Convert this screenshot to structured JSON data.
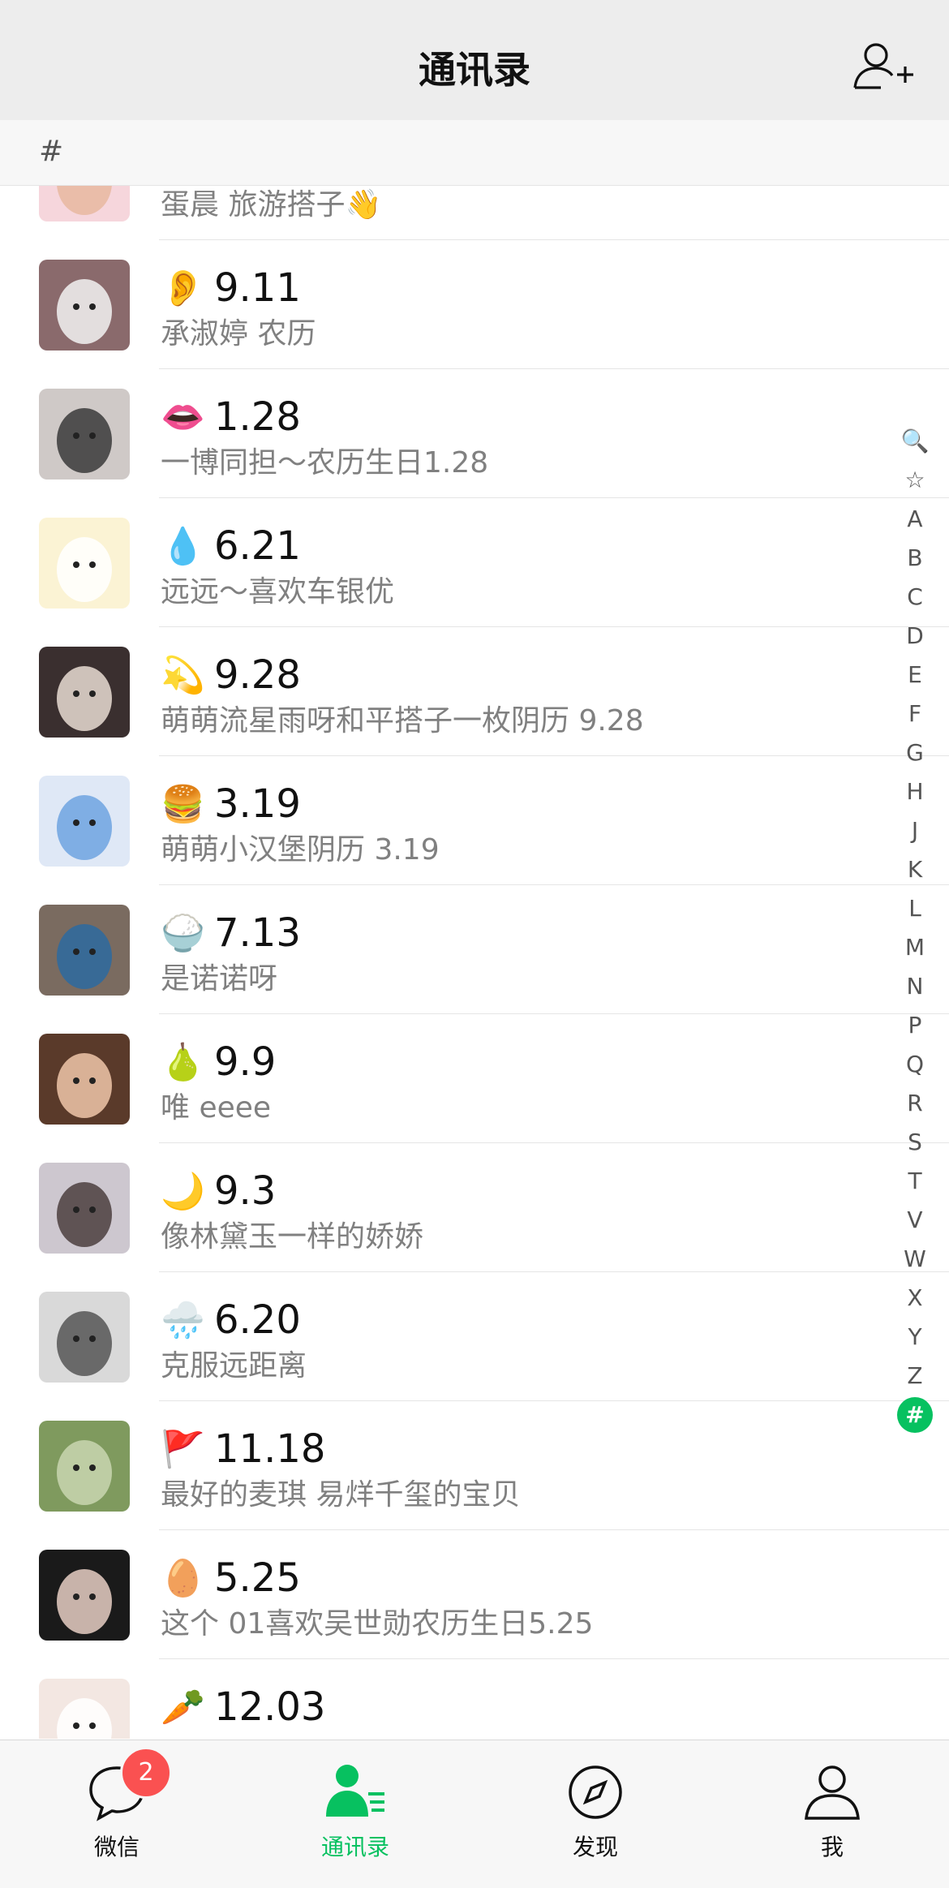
{
  "header": {
    "title": "通讯录",
    "add_icon": "add-contact-icon"
  },
  "section": {
    "label": "#"
  },
  "contacts": [
    {
      "emoji": "",
      "date": "",
      "subtitle": "蛋晨 旅游搭子👋",
      "avatar_color": "#f6d6dc",
      "avatar_accent": "#e8b9a0"
    },
    {
      "emoji": "👂",
      "date": "9.11",
      "subtitle": "承淑婷 农历",
      "avatar_color": "#8a6a6c",
      "avatar_accent": "#f2f2f2"
    },
    {
      "emoji": "👄",
      "date": "1.28",
      "subtitle": "一博同担～农历生日1.28",
      "avatar_color": "#cfc9c7",
      "avatar_accent": "#3a3a3a"
    },
    {
      "emoji": "💧",
      "date": "6.21",
      "subtitle": "远远～喜欢车银优",
      "avatar_color": "#fbf3d4",
      "avatar_accent": "#ffffff"
    },
    {
      "emoji": "💫",
      "date": "9.28",
      "subtitle": "萌萌流星雨呀和平搭子一枚阴历 9.28",
      "avatar_color": "#3a2f2f",
      "avatar_accent": "#e9dcd2"
    },
    {
      "emoji": "🍔",
      "date": "3.19",
      "subtitle": "萌萌小汉堡阴历 3.19",
      "avatar_color": "#dfe8f6",
      "avatar_accent": "#6fa3e0"
    },
    {
      "emoji": "🍚",
      "date": "7.13",
      "subtitle": "是诺诺呀",
      "avatar_color": "#7a6b60",
      "avatar_accent": "#2d6aa0"
    },
    {
      "emoji": "🍐",
      "date": "9.9",
      "subtitle": "唯 eeee",
      "avatar_color": "#5a3a2a",
      "avatar_accent": "#f0c7a9"
    },
    {
      "emoji": "🌙",
      "date": "9.3",
      "subtitle": "像林黛玉一样的娇娇",
      "avatar_color": "#cdc7cf",
      "avatar_accent": "#4b3e3e"
    },
    {
      "emoji": "🌧️",
      "date": "6.20",
      "subtitle": "克服远距离",
      "avatar_color": "#d9d9d9",
      "avatar_accent": "#555555"
    },
    {
      "emoji": "🚩",
      "date": "11.18",
      "subtitle": "最好的麦琪 易烊千玺的宝贝",
      "avatar_color": "#7f9a5e",
      "avatar_accent": "#c9d6b0"
    },
    {
      "emoji": "🥚",
      "date": "5.25",
      "subtitle": "这个 01喜欢吴世勋农历生日5.25",
      "avatar_color": "#1a1a1a",
      "avatar_accent": "#e7cfc4"
    },
    {
      "emoji": "🥕",
      "date": "12.03",
      "subtitle": "",
      "avatar_color": "#f3e7e2",
      "avatar_accent": "#ffffff"
    }
  ],
  "index_letters": [
    "🔍",
    "☆",
    "A",
    "B",
    "C",
    "D",
    "E",
    "F",
    "G",
    "H",
    "J",
    "K",
    "L",
    "M",
    "N",
    "P",
    "Q",
    "R",
    "S",
    "T",
    "V",
    "W",
    "X",
    "Y",
    "Z",
    "#"
  ],
  "index_active": "#",
  "tabs": [
    {
      "label": "微信",
      "icon": "chat-icon",
      "badge": "2"
    },
    {
      "label": "通讯录",
      "icon": "contacts-icon",
      "active": true
    },
    {
      "label": "发现",
      "icon": "compass-icon"
    },
    {
      "label": "我",
      "icon": "profile-icon"
    }
  ],
  "colors": {
    "accent": "#07c160",
    "badge": "#fa5151"
  }
}
